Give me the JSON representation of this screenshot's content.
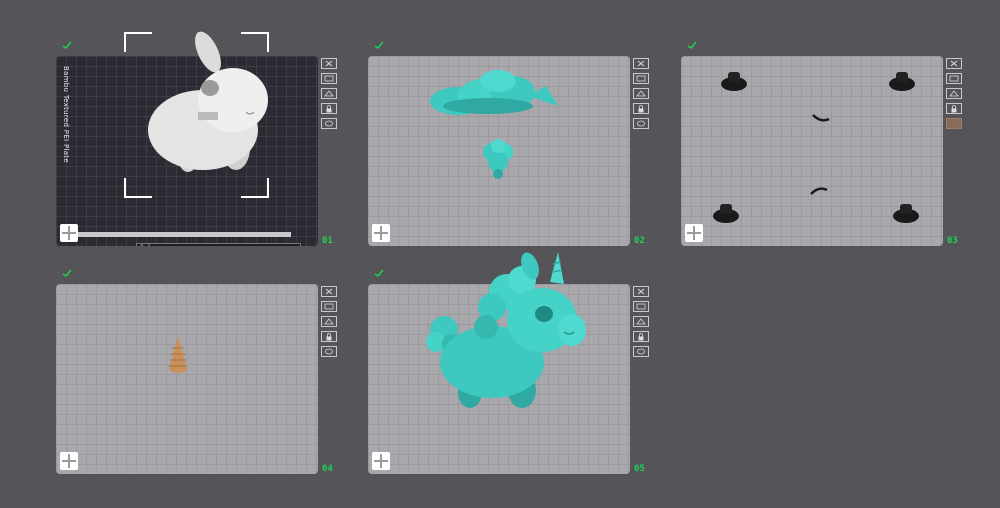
{
  "plates": [
    {
      "number": "01",
      "icon": "check-icon",
      "label": "Bambu Textured PEI Plate",
      "theme": "dark",
      "status_text": "0 1"
    },
    {
      "number": "02",
      "icon": "check-icon",
      "theme": "light"
    },
    {
      "number": "03",
      "icon": "check-icon",
      "theme": "light"
    },
    {
      "number": "04",
      "icon": "check-icon",
      "theme": "light"
    },
    {
      "number": "05",
      "icon": "check-icon",
      "theme": "light"
    }
  ],
  "tools": [
    "close-icon",
    "arrange-icon",
    "orient-icon",
    "lock-icon",
    "settings-icon"
  ],
  "colors": {
    "background": "#545459",
    "plate_light": "#a9a9ad",
    "plate_dark": "#2b2c33",
    "accent_green": "#1dd44f",
    "model_teal": "#3dc9bf",
    "model_white": "#e8e8e8",
    "model_tan": "#c9905a",
    "model_black": "#1a1a1a"
  }
}
